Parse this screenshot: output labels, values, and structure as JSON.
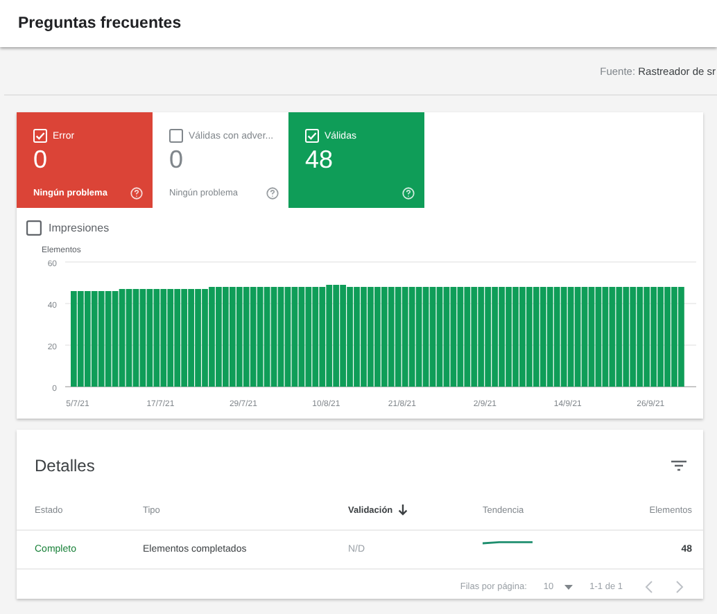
{
  "page": {
    "title": "Preguntas frecuentes",
    "source": "Fuente: **Rastreador de sr**"
  },
  "tiles": [
    {
      "kind": "error",
      "label": "Error",
      "checked": true,
      "count": "0",
      "note": "Ningún problema"
    },
    {
      "kind": "warning",
      "label": "Válidas con adver...",
      "checked": false,
      "count": "0",
      "note": "Ningún problema"
    },
    {
      "kind": "valid",
      "label": "Válidas",
      "checked": true,
      "count": "48"
    }
  ],
  "impressions": {
    "label": "Impresiones",
    "checked": false
  },
  "chart_data": {
    "type": "bar",
    "ylabel": "Elementos",
    "ylim": [
      0,
      60
    ],
    "yticks": [
      0,
      20,
      40,
      60
    ],
    "categories": [
      "5/7/21",
      null,
      null,
      null,
      null,
      null,
      null,
      null,
      null,
      null,
      null,
      null,
      "17/7/21",
      null,
      null,
      null,
      null,
      null,
      null,
      null,
      null,
      null,
      null,
      null,
      "29/7/21",
      null,
      null,
      null,
      null,
      null,
      null,
      null,
      null,
      null,
      null,
      null,
      "10/8/21",
      null,
      null,
      null,
      null,
      null,
      null,
      null,
      null,
      null,
      null,
      "21/8/21",
      null,
      null,
      null,
      null,
      null,
      null,
      null,
      null,
      null,
      null,
      null,
      "2/9/21",
      null,
      null,
      null,
      null,
      null,
      null,
      null,
      null,
      null,
      null,
      null,
      "14/9/21",
      null,
      null,
      null,
      null,
      null,
      null,
      null,
      null,
      null,
      null,
      null,
      "26/9/21",
      null,
      null,
      null,
      null,
      null
    ],
    "series": [
      {
        "color": "#0f9d58",
        "values": [
          46,
          46,
          46,
          46,
          46,
          46,
          46,
          47,
          47,
          47,
          47,
          47,
          47,
          47,
          47,
          47,
          47,
          47,
          47,
          47,
          48,
          48,
          48,
          48,
          48,
          48,
          48,
          48,
          48,
          48,
          48,
          48,
          48,
          48,
          48,
          48,
          48,
          49,
          49,
          49,
          48,
          48,
          48,
          48,
          48,
          48,
          48,
          48,
          48,
          48,
          48,
          48,
          48,
          48,
          48,
          48,
          48,
          48,
          48,
          48,
          48,
          48,
          48,
          48,
          48,
          48,
          48,
          48,
          48,
          48,
          48,
          48,
          48,
          48,
          48,
          48,
          48,
          48,
          48,
          48,
          48,
          48,
          48,
          48,
          48,
          48,
          48,
          48,
          48
        ]
      }
    ]
  },
  "details": {
    "title": "Detalles",
    "columns": [
      {
        "label": "Estado",
        "sorted": false
      },
      {
        "label": "Tipo",
        "sorted": false
      },
      {
        "label": "Validación",
        "sorted": true
      },
      {
        "label": "Tendencia",
        "sorted": false
      },
      {
        "label": "Elementos",
        "sorted": false
      }
    ],
    "rows": [
      {
        "estado": "Completo",
        "tipo": "Elementos completados",
        "validacion": "N/D",
        "elementos": "48"
      }
    ],
    "pagination": {
      "rows_label": "Filas por página:",
      "rows_value": "10",
      "range": "1-1 de 1"
    }
  }
}
